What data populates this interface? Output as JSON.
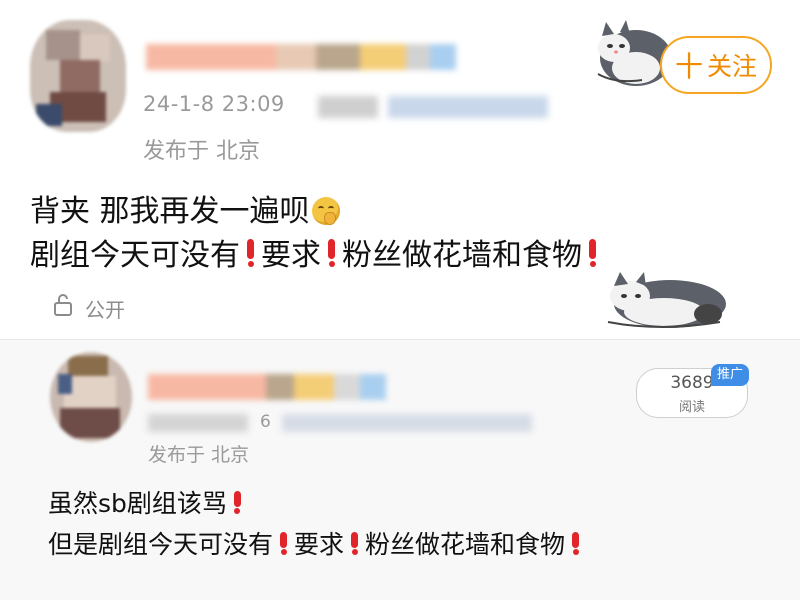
{
  "post": {
    "timestamp": "24-1-8 23:09",
    "location": "发布于 北京",
    "follow_label": "关注",
    "follow_plus": "十",
    "text_lines": [
      {
        "segments": [
          "背夹 那我再发一遍呗"
        ],
        "emoji": "shushing-face"
      },
      {
        "segments": [
          "剧组今天可没有",
          "要求",
          "粉丝做花墙和食物",
          ""
        ]
      }
    ],
    "visibility": "公开"
  },
  "repost": {
    "timestamp_partial": "6",
    "location": "发布于 北京",
    "read_count": "3689",
    "read_label": "阅读",
    "promo_badge": "推广",
    "text_lines": [
      {
        "segments": [
          "虽然sb剧组该骂",
          ""
        ]
      },
      {
        "segments": [
          "但是剧组今天可没有",
          "要求",
          "粉丝做花墙和食物",
          ""
        ]
      }
    ]
  },
  "colors": {
    "accent_orange": "#f08a00",
    "exclamation_red": "#e0262b",
    "promo_blue": "#3e8ee8",
    "meta_gray": "#9a9a9a"
  },
  "icons": {
    "follow": "plus-icon",
    "visibility": "unlock-icon",
    "emoji": "shushing-face-icon",
    "decoration": "cat-sticker-icon"
  }
}
